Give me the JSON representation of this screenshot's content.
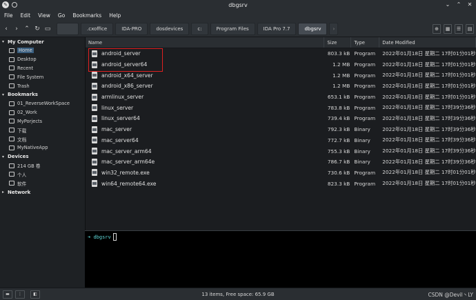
{
  "window": {
    "title": "dbgsrv"
  },
  "menu": [
    "File",
    "Edit",
    "View",
    "Go",
    "Bookmarks",
    "Help"
  ],
  "breadcrumbs": [
    ".cxoffice",
    "IDA-PRO",
    "dosdevices",
    "c:",
    "Program Files",
    "IDA Pro 7.7",
    "dbgsrv"
  ],
  "sidebar": {
    "my_computer": {
      "label": "My Computer",
      "items": [
        "Home",
        "Desktop",
        "Recent",
        "File System",
        "Trash"
      ]
    },
    "bookmarks": {
      "label": "Bookmarks",
      "items": [
        "01_ReverseWorkSpace",
        "02_Work",
        "MyPorjects",
        "下载",
        "文档",
        "MyNativeApp"
      ]
    },
    "devices": {
      "label": "Devices",
      "items": [
        "214 GB 卷",
        "个人",
        "软件"
      ]
    },
    "network": {
      "label": "Network"
    }
  },
  "columns": {
    "name": "Name",
    "size": "Size",
    "type": "Type",
    "date": "Date Modified"
  },
  "files": [
    {
      "name": "android_server",
      "size": "803.3 kB",
      "type": "Program",
      "date": "2022年01月18日 星期二 17时01分01秒"
    },
    {
      "name": "android_server64",
      "size": "1.2 MB",
      "type": "Program",
      "date": "2022年01月18日 星期二 17时01分01秒"
    },
    {
      "name": "android_x64_server",
      "size": "1.2 MB",
      "type": "Program",
      "date": "2022年01月18日 星期二 17时01分01秒"
    },
    {
      "name": "android_x86_server",
      "size": "1.2 MB",
      "type": "Program",
      "date": "2022年01月18日 星期二 17时01分01秒"
    },
    {
      "name": "armlinux_server",
      "size": "653.1 kB",
      "type": "Program",
      "date": "2022年01月18日 星期二 17时01分01秒"
    },
    {
      "name": "linux_server",
      "size": "783.8 kB",
      "type": "Program",
      "date": "2022年01月18日 星期二 17时39分36秒"
    },
    {
      "name": "linux_server64",
      "size": "739.4 kB",
      "type": "Program",
      "date": "2022年01月18日 星期二 17时39分36秒"
    },
    {
      "name": "mac_server",
      "size": "792.3 kB",
      "type": "Binary",
      "date": "2022年01月18日 星期二 17时39分36秒"
    },
    {
      "name": "mac_server64",
      "size": "772.7 kB",
      "type": "Binary",
      "date": "2022年01月18日 星期二 17时39分36秒"
    },
    {
      "name": "mac_server_arm64",
      "size": "755.3 kB",
      "type": "Binary",
      "date": "2022年01月18日 星期二 17时39分36秒"
    },
    {
      "name": "mac_server_arm64e",
      "size": "786.7 kB",
      "type": "Binary",
      "date": "2022年01月18日 星期二 17时39分36秒"
    },
    {
      "name": "win32_remote.exe",
      "size": "730.6 kB",
      "type": "Program",
      "date": "2022年01月18日 星期二 17时01分01秒"
    },
    {
      "name": "win64_remote64.exe",
      "size": "823.3 kB",
      "type": "Program",
      "date": "2022年01月18日 星期二 17时01分01秒"
    }
  ],
  "terminal": {
    "prompt_path": "dbgsrv"
  },
  "status": {
    "text": "13 items, Free space: 65.9 GB"
  },
  "watermark": "CSDN @Devil丶LY",
  "colors": {
    "highlight_box": "#e02020",
    "prompt": "#5fd7d7",
    "selection": "#3a5f80"
  }
}
